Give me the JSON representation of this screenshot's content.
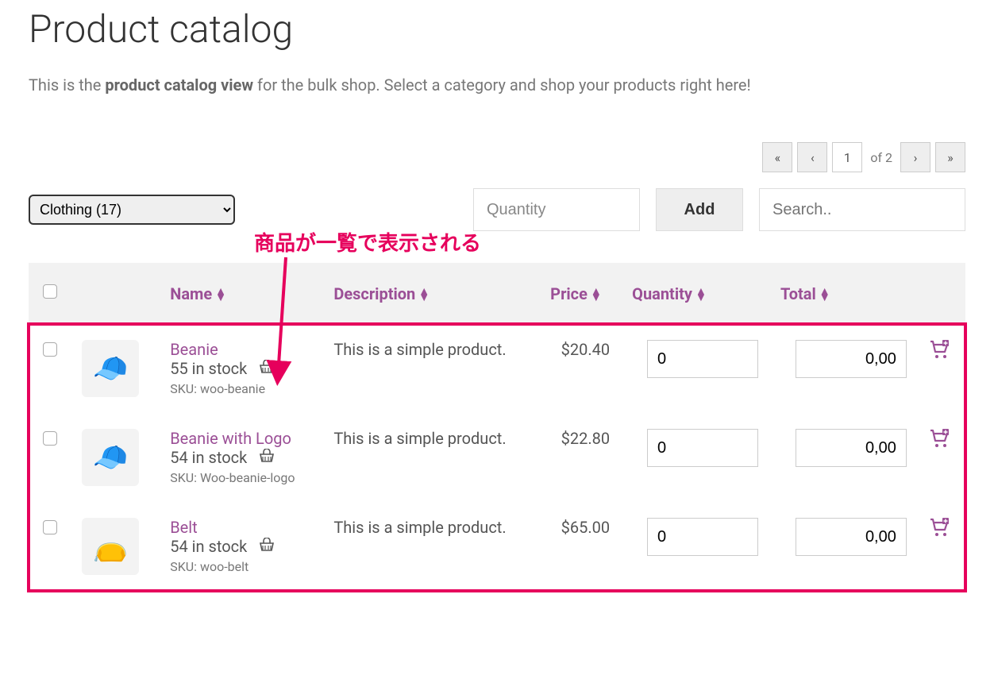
{
  "header": {
    "title": "Product catalog",
    "intro_prefix": "This is the ",
    "intro_bold": "product catalog view",
    "intro_suffix": " for the bulk shop. Select a category and shop your products right here!"
  },
  "pagination": {
    "first": "«",
    "prev": "‹",
    "current": "1",
    "of_label": "of 2",
    "next": "›",
    "last": "»"
  },
  "controls": {
    "category_selected": "Clothing  (17)",
    "quantity_placeholder": "Quantity",
    "add_label": "Add",
    "search_placeholder": "Search.."
  },
  "table_headers": {
    "name": "Name",
    "description": "Description",
    "price": "Price",
    "quantity": "Quantity",
    "total": "Total"
  },
  "annotation_label": "商品が一覧で表示される",
  "products": [
    {
      "name": "Beanie",
      "stock": "55 in stock",
      "sku": "SKU: woo-beanie",
      "description": "This is a simple product.",
      "price": "$20.40",
      "qty": "0",
      "total": "0,00",
      "emoji": "🧢",
      "thumb_color": "#f0b090"
    },
    {
      "name": "Beanie with Logo",
      "stock": "54 in stock",
      "sku": "SKU: Woo-beanie-logo",
      "description": "This is a simple product.",
      "price": "$22.80",
      "qty": "0",
      "total": "0,00",
      "emoji": "🧢",
      "thumb_color": "#8fc8e8"
    },
    {
      "name": "Belt",
      "stock": "54 in stock",
      "sku": "SKU: woo-belt",
      "description": "This is a simple product.",
      "price": "$65.00",
      "qty": "0",
      "total": "0,00",
      "emoji": "👝",
      "thumb_color": "#c8b088"
    }
  ]
}
